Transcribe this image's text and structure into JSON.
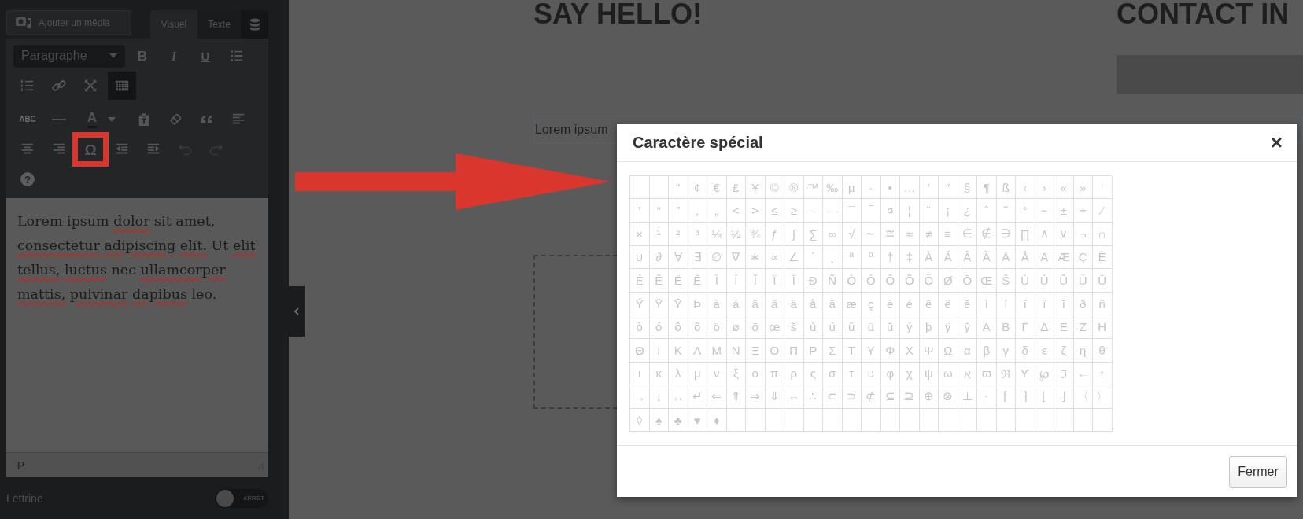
{
  "editor_panel": {
    "add_media_button": "Ajouter un média",
    "tabs": [
      {
        "kind": "text",
        "label": "Visuel",
        "selected": true
      },
      {
        "kind": "text",
        "label": "Texte",
        "selected": false
      },
      {
        "kind": "database",
        "selected": false
      }
    ],
    "format_select": "Paragraphe",
    "toolbars": [
      [
        {
          "kind": "bold",
          "label": "B",
          "active": false,
          "disabled": false,
          "highlighted": false
        },
        {
          "kind": "italic",
          "label": "I",
          "active": false,
          "disabled": false,
          "highlighted": false
        },
        {
          "kind": "underline",
          "label": "U",
          "active": false,
          "disabled": false,
          "highlighted": false
        },
        {
          "kind": "bullet-list",
          "active": false,
          "disabled": false,
          "highlighted": false
        },
        {
          "kind": "numbered-list",
          "active": false,
          "disabled": false,
          "highlighted": false
        },
        {
          "kind": "link",
          "active": false,
          "disabled": false,
          "highlighted": false
        },
        {
          "kind": "fullscreen",
          "active": false,
          "disabled": false,
          "highlighted": false
        },
        {
          "kind": "toolbar-toggle",
          "active": true,
          "disabled": false,
          "highlighted": false
        }
      ],
      [
        {
          "kind": "strikethrough",
          "label": "ABC",
          "active": false,
          "disabled": false,
          "highlighted": false
        },
        {
          "kind": "horizontal-line",
          "active": false,
          "disabled": false,
          "highlighted": false
        },
        {
          "kind": "text-color",
          "label": "A",
          "active": false,
          "disabled": false,
          "highlighted": false
        },
        {
          "kind": "paste-text",
          "active": false,
          "disabled": false,
          "highlighted": false
        },
        {
          "kind": "clear-formatting",
          "active": false,
          "disabled": false,
          "highlighted": false
        },
        {
          "kind": "blockquote",
          "active": false,
          "disabled": false,
          "highlighted": false
        },
        {
          "kind": "align-left",
          "active": false,
          "disabled": false,
          "highlighted": false
        },
        {
          "kind": "align-center",
          "active": false,
          "disabled": false,
          "highlighted": false
        },
        {
          "kind": "align-right",
          "active": false,
          "disabled": false,
          "highlighted": false
        },
        {
          "kind": "special-character",
          "label": "Ω",
          "active": false,
          "disabled": false,
          "highlighted": true
        },
        {
          "kind": "outdent",
          "active": false,
          "disabled": false,
          "highlighted": false
        },
        {
          "kind": "indent",
          "active": false,
          "disabled": false,
          "highlighted": false
        },
        {
          "kind": "undo",
          "active": false,
          "disabled": true,
          "highlighted": false
        },
        {
          "kind": "redo",
          "active": false,
          "disabled": true,
          "highlighted": false
        },
        {
          "kind": "help",
          "label": "?",
          "active": false,
          "disabled": false,
          "highlighted": false
        }
      ]
    ],
    "content": [
      {
        "text": "Lorem ipsum",
        "misspelled": false
      },
      {
        "text": "dolor",
        "misspelled": true
      },
      {
        "text": "sit amet,",
        "misspelled": false
      },
      {
        "text": "consectetur",
        "misspelled": true
      },
      {
        "text": "adipiscing",
        "misspelled": true
      },
      {
        "text": "elit.",
        "misspelled": true
      },
      {
        "text": "Ut",
        "misspelled": false
      },
      {
        "text": "elit",
        "misspelled": true
      },
      {
        "text": "tellus,",
        "misspelled": true
      },
      {
        "text": "luctus",
        "misspelled": true
      },
      {
        "text": "nec",
        "misspelled": false
      },
      {
        "text": "ullamcorper",
        "misspelled": true
      },
      {
        "text": "mattis,",
        "misspelled": true
      },
      {
        "text": "pulvinar",
        "misspelled": true
      },
      {
        "text": "dapibus",
        "misspelled": true
      },
      {
        "text": "leo.",
        "misspelled": false
      }
    ],
    "status_path": "P",
    "dropcap": {
      "label": "Lettrine",
      "toggle_text": "ARRÊT",
      "on": false
    }
  },
  "page": {
    "heading_left": "SAY HELLO!",
    "heading_right": "CONTACT IN",
    "text_field": "Lorem ipsum"
  },
  "dialog": {
    "title": "Caractère spécial",
    "close": "×",
    "leading_cells": [
      {
        "kind": "blank"
      },
      {
        "kind": "blank"
      }
    ],
    "characters": [
      "\"",
      "¢",
      "€",
      "£",
      "¥",
      "©",
      "®",
      "™",
      "‰",
      "µ",
      "·",
      "•",
      "…",
      "′",
      "″",
      "§",
      "¶",
      "ß",
      "‹",
      "›",
      "«",
      "»",
      "‘",
      "’",
      "“",
      "”",
      "‚",
      "„",
      "<",
      ">",
      "≤",
      "≥",
      "–",
      "—",
      "¯",
      "‾",
      "¤",
      "¦",
      "¨",
      "¡",
      "¿",
      "ˆ",
      "˜",
      "°",
      "−",
      "±",
      "÷",
      "⁄",
      "×",
      "¹",
      "²",
      "³",
      "¼",
      "½",
      "¾",
      "ƒ",
      "∫",
      "∑",
      "∞",
      "√",
      "∼",
      "≅",
      "≈",
      "≠",
      "≡",
      "∈",
      "∉",
      "∋",
      "∏",
      "∧",
      "∨",
      "¬",
      "∩",
      "∪",
      "∂",
      "∀",
      "∃",
      "∅",
      "∇",
      "∗",
      "∝",
      "∠",
      "´",
      "¸",
      "ª",
      "º",
      "†",
      "‡",
      "À",
      "Á",
      "Â",
      "Ã",
      "Ä",
      "Å",
      "Ā",
      "Æ",
      "Ç",
      "È",
      "É",
      "Ê",
      "Ë",
      "Ē",
      "Ì",
      "Í",
      "Î",
      "Ï",
      "Ī",
      "Ð",
      "Ñ",
      "Ò",
      "Ó",
      "Ô",
      "Õ",
      "Ö",
      "Ø",
      "Ō",
      "Œ",
      "Š",
      "Ù",
      "Ú",
      "Û",
      "Ü",
      "Ū",
      "Ý",
      "Ÿ",
      "Ȳ",
      "Þ",
      "à",
      "á",
      "â",
      "ã",
      "ä",
      "å",
      "ā",
      "æ",
      "ç",
      "è",
      "é",
      "ê",
      "ë",
      "ē",
      "ì",
      "í",
      "î",
      "ï",
      "ī",
      "ð",
      "ñ",
      "ò",
      "ó",
      "ô",
      "õ",
      "ö",
      "ø",
      "ō",
      "œ",
      "š",
      "ù",
      "ú",
      "û",
      "ü",
      "ū",
      "ý",
      "þ",
      "ÿ",
      "ȳ",
      "Α",
      "Β",
      "Γ",
      "Δ",
      "Ε",
      "Ζ",
      "Η",
      "Θ",
      "Ι",
      "Κ",
      "Λ",
      "Μ",
      "Ν",
      "Ξ",
      "Ο",
      "Π",
      "Ρ",
      "Σ",
      "Τ",
      "Υ",
      "Φ",
      "Χ",
      "Ψ",
      "Ω",
      "α",
      "β",
      "γ",
      "δ",
      "ε",
      "ζ",
      "η",
      "θ",
      "ι",
      "κ",
      "λ",
      "μ",
      "ν",
      "ξ",
      "ο",
      "π",
      "ρ",
      "ς",
      "σ",
      "τ",
      "υ",
      "φ",
      "χ",
      "ψ",
      "ω",
      "ℵ",
      "ϖ",
      "ℜ",
      "ϒ",
      "℘",
      "ℑ",
      "←",
      "↑",
      "→",
      "↓",
      "↔",
      "↵",
      "⇐",
      "⇑",
      "⇒",
      "⇓",
      "⇔",
      "∴",
      "⊂",
      "⊃",
      "⊄",
      "⊆",
      "⊇",
      "⊕",
      "⊗",
      "⊥",
      "⋅",
      "⌈",
      "⌉",
      "⌊",
      "⌋",
      "〈",
      "〉",
      "◊",
      "♠",
      "♣",
      "♥",
      "♦"
    ],
    "button": "Fermer"
  }
}
